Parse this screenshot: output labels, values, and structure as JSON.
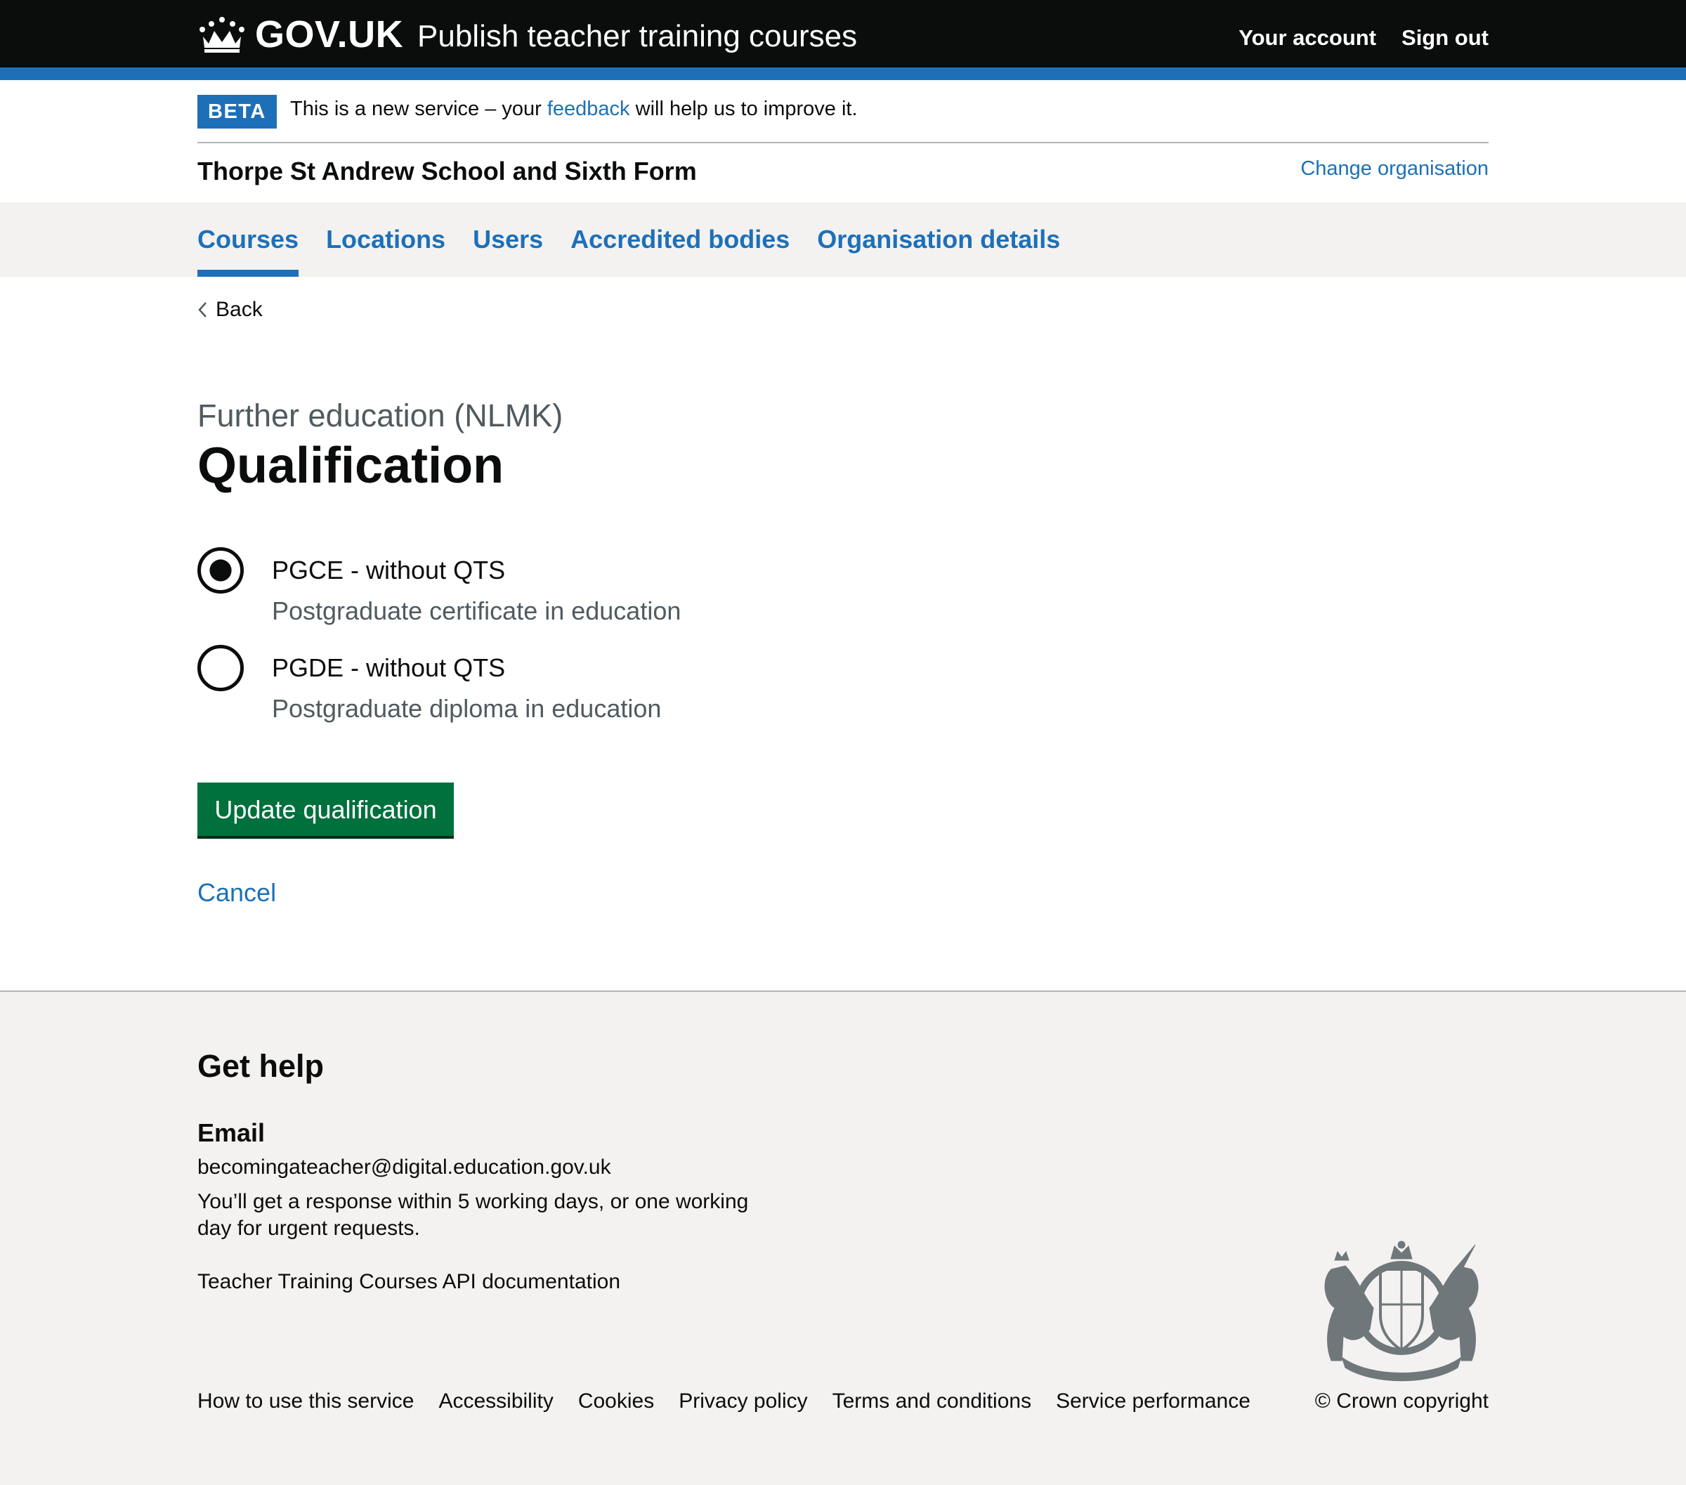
{
  "header": {
    "logo_text": "GOV.UK",
    "service_name": "Publish teacher training courses",
    "nav": [
      "Your account",
      "Sign out"
    ]
  },
  "phase_banner": {
    "tag": "BETA",
    "text_before": "This is a new service – your ",
    "link": "feedback",
    "text_after": " will help us to improve it."
  },
  "organisation": {
    "name": "Thorpe St Andrew School and Sixth Form",
    "change_link": "Change organisation"
  },
  "primary_nav": {
    "items": [
      "Courses",
      "Locations",
      "Users",
      "Accredited bodies",
      "Organisation details"
    ],
    "active": "Courses"
  },
  "back_link": "Back",
  "page": {
    "caption": "Further education (NLMK)",
    "heading": "Qualification",
    "options": [
      {
        "label": "PGCE - without QTS",
        "hint": "Postgraduate certificate in education",
        "checked": true
      },
      {
        "label": "PGDE - without QTS",
        "hint": "Postgraduate diploma in education",
        "checked": false
      }
    ],
    "submit": "Update qualification",
    "cancel": "Cancel"
  },
  "footer": {
    "help_title": "Get help",
    "email_title": "Email",
    "email": "becomingateacher@digital.education.gov.uk",
    "response": "You’ll get a response within 5 working days, or one working day for urgent requests.",
    "api_link": "Teacher Training Courses API documentation",
    "links": [
      "How to use this service",
      "Accessibility",
      "Cookies",
      "Privacy policy",
      "Terms and conditions",
      "Service performance"
    ],
    "copyright": "© Crown copyright"
  },
  "colors": {
    "header_bg": "#0b0c0c",
    "brand_blue": "#1d70b8",
    "button_green": "#00703c",
    "footer_bg": "#f3f2f1",
    "secondary_text": "#505a5f"
  }
}
